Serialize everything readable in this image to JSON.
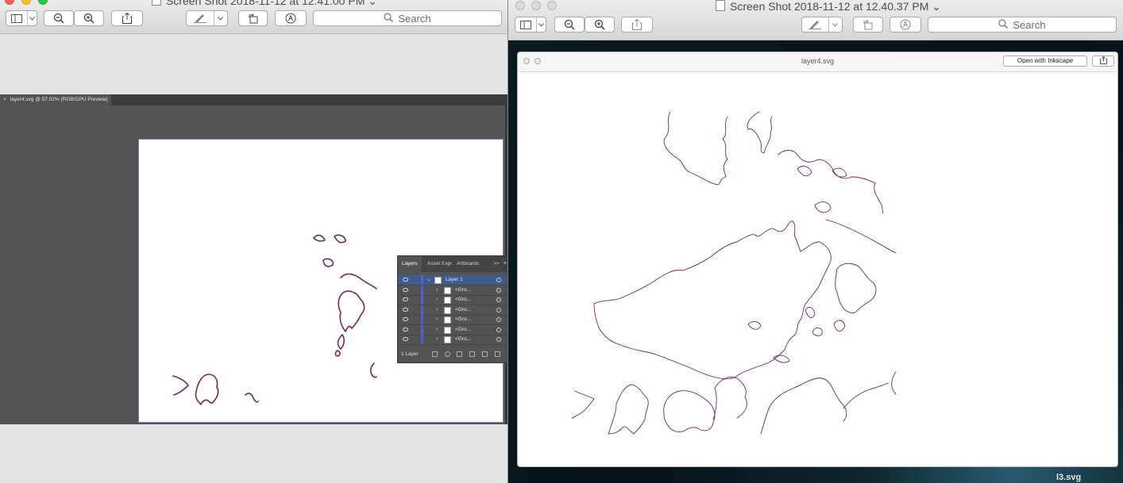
{
  "left_window": {
    "title": "Screen Shot 2018-11-12 at 12.41.00 PM",
    "search_placeholder": "Search",
    "illustrator": {
      "doc_tab": "layer4.svg @ 57.02% (RGB/GPU Preview)",
      "close_glyph": "×",
      "layers_panel": {
        "tabs": [
          "Layers",
          "Asset Expo",
          "Artboards"
        ],
        "more_glyph": ">>",
        "menu_glyph": "≡",
        "rows": [
          {
            "label": "Layer 1",
            "selected": true
          },
          {
            "label": "<Gro...",
            "selected": false
          },
          {
            "label": "<Gro...",
            "selected": false
          },
          {
            "label": "<Gro...",
            "selected": false
          },
          {
            "label": "<Gro...",
            "selected": false
          },
          {
            "label": "<Gro...",
            "selected": false
          },
          {
            "label": "<Gro...",
            "selected": false
          }
        ],
        "footer": "1 Layer"
      },
      "stroke_color": "#6b2a63"
    }
  },
  "right_window": {
    "title": "Screen Shot 2018-11-12 at 12.40.37 PM",
    "search_placeholder": "Search",
    "quicklook": {
      "title": "layer4.svg",
      "open_button": "Open with Inkscape",
      "stroke_color": "#6b2a63"
    },
    "bottom_label": "l3.svg"
  },
  "icons": {
    "sidebar": "sidebar-toggle-icon",
    "zoom_out": "zoom-out-icon",
    "zoom_in": "zoom-in-icon",
    "share": "share-icon",
    "markup": "markup-pen-icon",
    "rotate": "rotate-icon",
    "annotate": "annotate-icon",
    "search": "search-icon"
  }
}
